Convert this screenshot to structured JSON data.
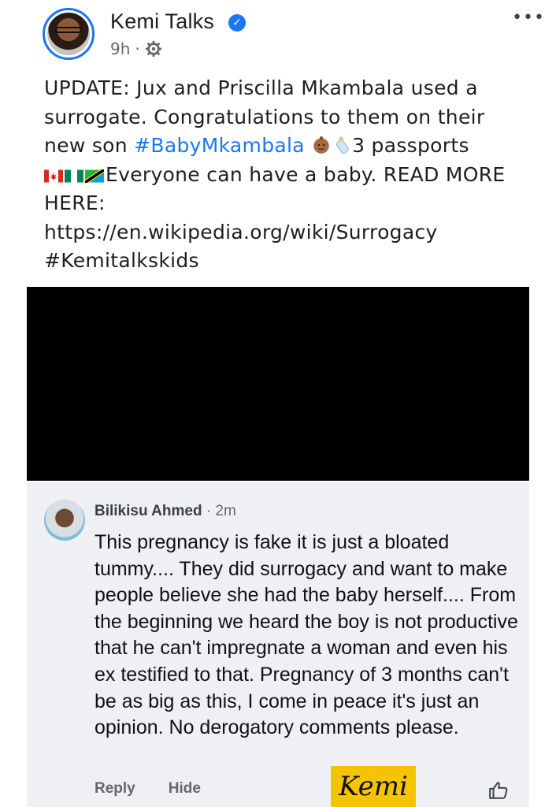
{
  "post": {
    "author": "Kemi Talks",
    "verified_icon": "verified-badge-icon",
    "time": "9h",
    "separator": "·",
    "audience_icon": "gear-icon",
    "more_label": "•••",
    "text": {
      "line1": "UPDATE: Jux and Priscilla Mkambala used a surrogate. Congratulations to them on their new son ",
      "hashtag_baby": "#BabyMkambala",
      "emoji1": "baby-emoji",
      "emoji2": "bottle-emoji",
      "passports": "3 passports",
      "flags": [
        "canada-flag",
        "nigeria-flag",
        "tanzania-flag"
      ],
      "after_flags": "Everyone can have a baby. READ MORE HERE:",
      "link": "https://en.wikipedia.org/wiki/Surrogacy",
      "hashtag_end": "#Kemitalkskids"
    }
  },
  "media": {
    "color": "#000000"
  },
  "comment": {
    "author": "Bilikisu Ahmed",
    "time": "· 2m",
    "body": "This pregnancy is fake it is just a bloated tummy.... They did surrogacy and want to make people believe she had the baby herself.... From the beginning we heard the boy is not productive that he can't impregnate a woman and even his ex testified to that. Pregnancy of 3 months can't be as big as this, I come in peace it's just an opinion. No derogatory comments please.",
    "reply_label": "Reply",
    "hide_label": "Hide",
    "like_icon": "thumbs-up-icon",
    "watermark": "Kemi"
  },
  "colors": {
    "accent": "#1877f2",
    "text": "#1c1e21",
    "muted": "#65676b",
    "comment_bg": "#eef0f3",
    "watermark_bg": "#f4c400"
  }
}
